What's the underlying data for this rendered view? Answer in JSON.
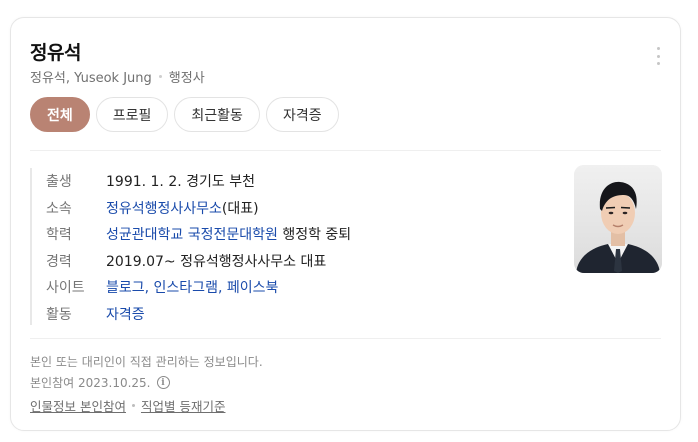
{
  "profile": {
    "name": "정유석",
    "subtitle_name": "정유석, Yuseok Jung",
    "occupation": "행정사"
  },
  "tabs": [
    {
      "label": "전체",
      "active": true
    },
    {
      "label": "프로필",
      "active": false
    },
    {
      "label": "최근활동",
      "active": false
    },
    {
      "label": "자격증",
      "active": false
    }
  ],
  "info": {
    "birth": {
      "label": "출생",
      "value": "1991. 1. 2. 경기도 부천"
    },
    "affiliation": {
      "label": "소속",
      "link": "정유석행정사사무소",
      "suffix": "(대표)"
    },
    "education": {
      "label": "학력",
      "link": "성균관대학교 국정전문대학원",
      "suffix": " 행정학 중퇴"
    },
    "career": {
      "label": "경력",
      "value": "2019.07~ 정유석행정사사무소 대표"
    },
    "site": {
      "label": "사이트",
      "links": [
        "블로그",
        "인스타그램",
        "페이스북"
      ],
      "separator": ", "
    },
    "activity": {
      "label": "활동",
      "link": "자격증"
    }
  },
  "footer": {
    "note": "본인 또는 대리인이 직접 관리하는 정보입니다.",
    "date": "본인참여 2023.10.25.",
    "links": [
      "인물정보 본인참여",
      "직업별 등재기준"
    ]
  },
  "colors": {
    "active_tab": "#b98373",
    "link": "#1a4bab"
  },
  "icons": {
    "more": "more-vertical-icon",
    "info": "info-circle-icon"
  }
}
